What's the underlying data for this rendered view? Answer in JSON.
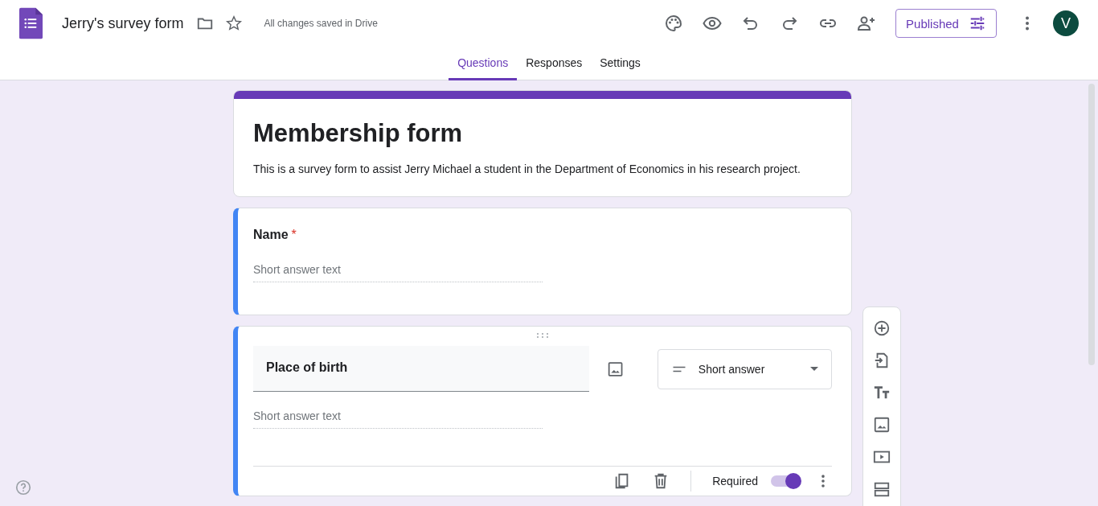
{
  "header": {
    "title": "Jerry's survey form",
    "save_status": "All changes saved in Drive",
    "publish_button": "Published",
    "avatar": "V"
  },
  "tabs": [
    {
      "label": "Questions",
      "selected": true
    },
    {
      "label": "Responses",
      "selected": false
    },
    {
      "label": "Settings",
      "selected": false
    }
  ],
  "form": {
    "title": "Membership form",
    "description": "This is a survey form to assist Jerry Michael a student in the Department of Economics in his research project."
  },
  "questions": [
    {
      "title": "Name",
      "placeholder": "Short answer text",
      "required": true,
      "required_mark": "*",
      "active": false
    },
    {
      "title": "Place of birth",
      "placeholder": "Short answer text",
      "required": true,
      "active": true,
      "type": "Short answer",
      "required_label": "Required"
    }
  ]
}
